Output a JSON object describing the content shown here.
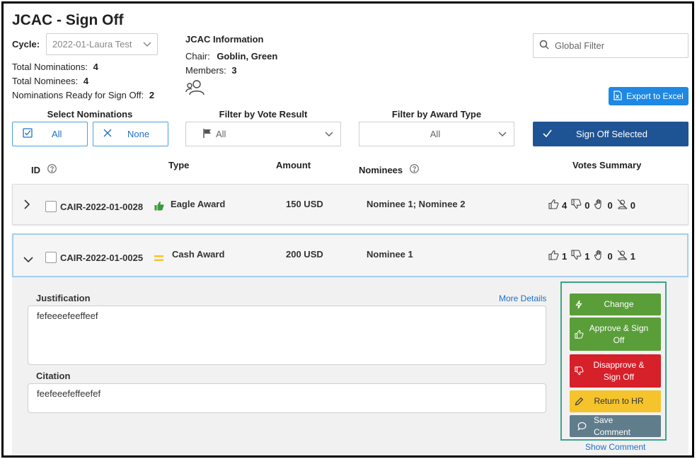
{
  "page": {
    "title": "JCAC - Sign Off"
  },
  "cycle": {
    "label": "Cycle:",
    "value": "2022-01-Laura Test"
  },
  "stats": {
    "total_nominations_label": "Total Nominations:",
    "total_nominations": "4",
    "total_nominees_label": "Total Nominees:",
    "total_nominees": "4",
    "ready_label": "Nominations Ready for Sign Off:",
    "ready": "2"
  },
  "jcac": {
    "heading": "JCAC Information",
    "chair_label": "Chair:",
    "chair": "Goblin, Green",
    "members_label": "Members:",
    "members": "3"
  },
  "global_filter": {
    "placeholder": "Global Filter"
  },
  "export": {
    "label": "Export to Excel"
  },
  "select_nominations": {
    "heading": "Select Nominations",
    "all_label": "All",
    "none_label": "None"
  },
  "vote_filter": {
    "heading": "Filter by Vote Result",
    "value": "All"
  },
  "award_filter": {
    "heading": "Filter by Award Type",
    "value": "All"
  },
  "sign_off_selected": {
    "label": "Sign Off Selected"
  },
  "columns": {
    "id": "ID",
    "type": "Type",
    "amount": "Amount",
    "nominees": "Nominees",
    "votes": "Votes Summary"
  },
  "rows": [
    {
      "id": "CAIR-2022-01-0028",
      "status_icon": "thumbs-up-green-icon",
      "type": "Eagle Award",
      "amount": "150 USD",
      "nominees": "Nominee 1; Nominee 2",
      "approve": "4",
      "disapprove": "0",
      "abstain": "0",
      "no_vote": "0"
    },
    {
      "id": "CAIR-2022-01-0025",
      "status_icon": "equals-yellow-icon",
      "type": "Cash Award",
      "amount": "200 USD",
      "nominees": "Nominee 1",
      "approve": "1",
      "disapprove": "1",
      "abstain": "0",
      "no_vote": "1"
    }
  ],
  "detail": {
    "justification_label": "Justification",
    "more_details": "More Details",
    "justification": "fefeeeefeeffeef",
    "citation_label": "Citation",
    "citation": "feefeeefeffeefef",
    "show_comment": "Show Comment"
  },
  "actions": {
    "change": "Change",
    "approve": "Approve & Sign Off",
    "disapprove": "Disapprove & Sign Off",
    "return": "Return to HR",
    "save": "Save Comment"
  },
  "colors": {
    "primary": "#1f5494",
    "accent": "#1e88e5",
    "green": "#5a9e3a",
    "red": "#d6202a",
    "yellow": "#f5c42c",
    "slate": "#607d8b"
  }
}
